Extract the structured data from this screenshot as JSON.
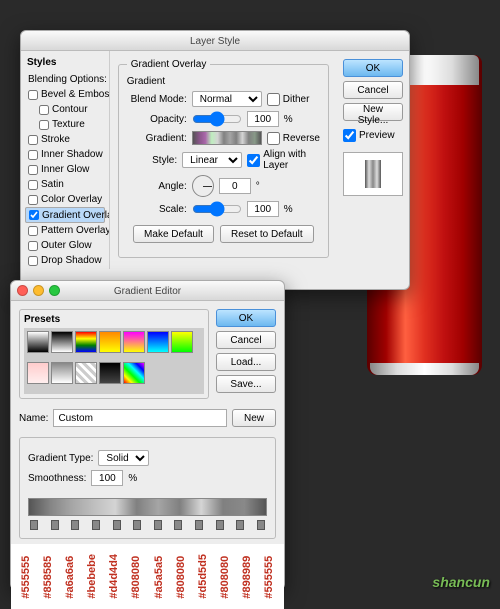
{
  "layerStyle": {
    "title": "Layer Style",
    "sidebar": {
      "heading": "Styles",
      "blending": "Blending Options: Default",
      "items": [
        "Bevel & Emboss",
        "Contour",
        "Texture",
        "Stroke",
        "Inner Shadow",
        "Inner Glow",
        "Satin",
        "Color Overlay",
        "Gradient Overlay",
        "Pattern Overlay",
        "Outer Glow",
        "Drop Shadow"
      ],
      "selected": "Gradient Overlay",
      "checked": [
        "Gradient Overlay"
      ]
    },
    "panel": {
      "groupTitle": "Gradient Overlay",
      "subTitle": "Gradient",
      "blendModeLabel": "Blend Mode:",
      "blendMode": "Normal",
      "ditherLabel": "Dither",
      "opacityLabel": "Opacity:",
      "opacity": "100",
      "pct": "%",
      "gradientLabel": "Gradient:",
      "reverseLabel": "Reverse",
      "styleLabel": "Style:",
      "style": "Linear",
      "alignLabel": "Align with Layer",
      "angleLabel": "Angle:",
      "angle": "0",
      "deg": "°",
      "scaleLabel": "Scale:",
      "scale": "100",
      "makeDefault": "Make Default",
      "resetDefault": "Reset to Default"
    },
    "buttons": {
      "ok": "OK",
      "cancel": "Cancel",
      "newStyle": "New Style...",
      "preview": "Preview"
    }
  },
  "gradientEditor": {
    "title": "Gradient Editor",
    "presets": "Presets",
    "name": "Name:",
    "nameValue": "Custom",
    "new": "New",
    "typeLabel": "Gradient Type:",
    "type": "Solid",
    "smoothLabel": "Smoothness:",
    "smooth": "100",
    "pct": "%",
    "buttons": {
      "ok": "OK",
      "cancel": "Cancel",
      "load": "Load...",
      "save": "Save..."
    },
    "hexStops": [
      "#555555",
      "#858585",
      "#a6a6a6",
      "#bebebe",
      "#d4d4d4",
      "#808080",
      "#a5a5a5",
      "#808080",
      "#d5d5d5",
      "#808080",
      "#898989",
      "#555555"
    ]
  },
  "watermark": "shancun"
}
